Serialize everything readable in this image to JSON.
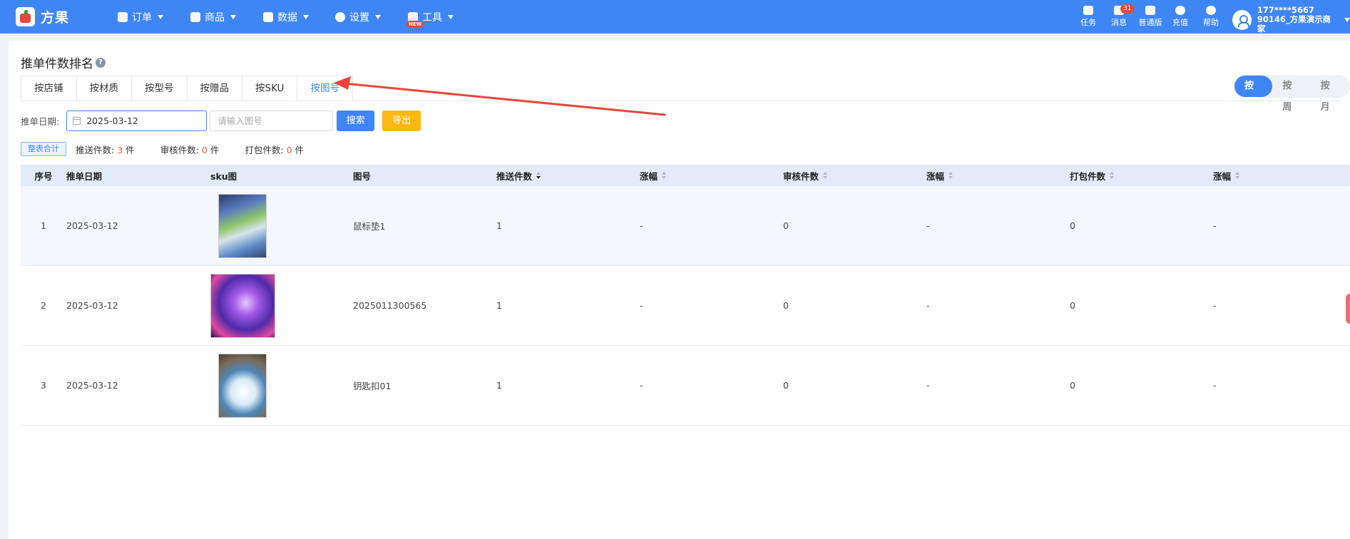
{
  "app": {
    "name": "方果"
  },
  "nav": [
    {
      "label": "订单",
      "icon": "clipboard-icon"
    },
    {
      "label": "商品",
      "icon": "bag-icon"
    },
    {
      "label": "数据",
      "icon": "chart-icon"
    },
    {
      "label": "设置",
      "icon": "gear-icon"
    },
    {
      "label": "工具",
      "icon": "box-icon",
      "badge": "NEW"
    }
  ],
  "toolbar": [
    {
      "label": "任务",
      "icon": "task-icon"
    },
    {
      "label": "消息",
      "icon": "message-icon",
      "badge": "31"
    },
    {
      "label": "普通版",
      "icon": "shirt-icon"
    },
    {
      "label": "充值",
      "icon": "coin-icon"
    },
    {
      "label": "帮助",
      "icon": "help-icon"
    }
  ],
  "user": {
    "phone": "177****5667",
    "shop": "90146_方果演示商家"
  },
  "page": {
    "title": "推单件数排名",
    "help": "?"
  },
  "tabs": [
    "按店铺",
    "按材质",
    "按型号",
    "按赠品",
    "按SKU",
    "按图号"
  ],
  "active_tab": "按图号",
  "period": [
    "按日",
    "按周",
    "按月"
  ],
  "active_period": "按日",
  "filter": {
    "date_label": "推单日期:",
    "date_value": "2025-03-12",
    "figure_placeholder": "请输入图号",
    "search_label": "搜索",
    "export_label": "导出"
  },
  "summary": {
    "tag": "整表合计",
    "push_label": "推送件数:",
    "push_value": "3",
    "push_unit": "件",
    "review_label": "审核件数:",
    "review_value": "0",
    "review_unit": "件",
    "pack_label": "打包件数:",
    "pack_value": "0",
    "pack_unit": "件"
  },
  "table": {
    "headers": [
      "序号",
      "推单日期",
      "sku图",
      "图号",
      "推送件数",
      "涨幅",
      "审核件数",
      "涨幅",
      "打包件数",
      "涨幅"
    ],
    "rows": [
      {
        "index": "1",
        "date": "2025-03-12",
        "image": "mousepad-photo",
        "figure": "鼠标垫1",
        "push": "1",
        "push_change": "-",
        "review": "0",
        "review_change": "-",
        "pack": "0",
        "pack_change": "-"
      },
      {
        "index": "2",
        "date": "2025-03-12",
        "image": "anime-figure-photo",
        "figure": "2025011300565",
        "push": "1",
        "push_change": "-",
        "review": "0",
        "review_change": "-",
        "pack": "0",
        "pack_change": "-"
      },
      {
        "index": "3",
        "date": "2025-03-12",
        "image": "keychain-photo",
        "figure": "钥匙扣01",
        "push": "1",
        "push_change": "-",
        "review": "0",
        "review_change": "-",
        "pack": "0",
        "pack_change": "-"
      }
    ]
  },
  "colors": {
    "primary": "#3f86f5",
    "warning": "#fdb813",
    "danger": "#f25b4a",
    "annotation_arrow": "#e8453c"
  }
}
